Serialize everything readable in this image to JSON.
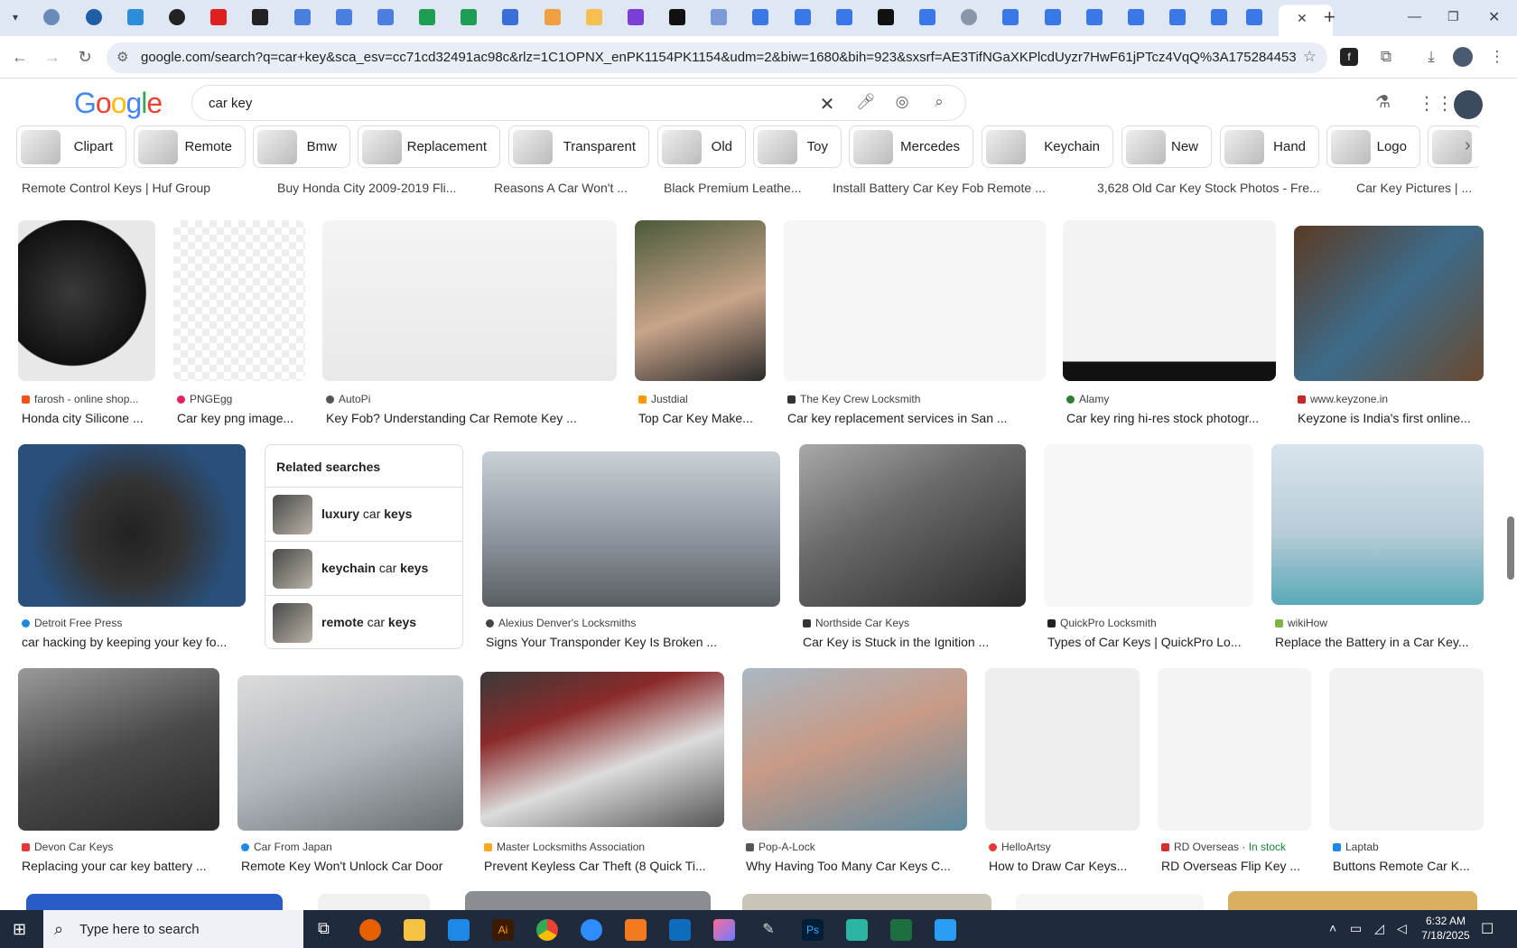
{
  "browser": {
    "url": "google.com/search?q=car+key&sca_esv=cc71cd32491ac98c&rlz=1C1OPNX_enPK1154PK1154&udm=2&biw=1680&bih=923&sxsrf=AE3TifNGaXKPlcdUyzr7HwF61jPTcz4VqQ%3A1752844531044&ei=80h...",
    "tab_close": "✕",
    "new_tab": "+"
  },
  "search": {
    "logo_letters": [
      "G",
      "o",
      "o",
      "g",
      "l",
      "e"
    ],
    "logo_colors": [
      "#4285F4",
      "#EA4335",
      "#FBBC05",
      "#4285F4",
      "#34A853",
      "#EA4335"
    ],
    "query": "car key"
  },
  "chips": [
    "Clipart",
    "Remote",
    "Bmw",
    "Replacement",
    "Transparent",
    "Old",
    "Toy",
    "Mercedes",
    "Keychain",
    "New",
    "Hand",
    "Logo"
  ],
  "top_captions": [
    "Remote Control Keys | Huf Group",
    "Buy Honda City 2009-2019 Fli...",
    "Reasons A Car Won't ...",
    "Black Premium Leathe...",
    "Install Battery Car Key Fob Remote ...",
    "3,628 Old Car Key Stock Photos - Fre...",
    "Car Key Pictures | ..."
  ],
  "rows": [
    [
      {
        "source": "farosh - online shop...",
        "title": "Honda city Silicone ...",
        "color": "#f4511e"
      },
      {
        "source": "PNGEgg",
        "title": "Car key png image...",
        "color": "#e91e63"
      },
      {
        "source": "AutoPi",
        "title": "Key Fob? Understanding Car Remote Key ...",
        "color": "#555555"
      },
      {
        "source": "Justdial",
        "title": "Top Car Key Make...",
        "color": "#ff9800"
      },
      {
        "source": "The Key Crew Locksmith",
        "title": "Car key replacement services in San ...",
        "color": "#333333"
      },
      {
        "source": "Alamy",
        "title": "Car key ring hi-res stock photogr...",
        "color": "#2e7d32"
      },
      {
        "source": "www.keyzone.in",
        "title": "Keyzone is India's first online...",
        "color": "#c62828"
      }
    ],
    [
      {
        "source": "Detroit Free Press",
        "title": "car hacking by keeping your key fo...",
        "color": "#1e88e5"
      },
      {
        "source": "Alexius Denver's Locksmiths",
        "title": "Signs Your Transponder Key Is Broken ...",
        "color": "#444444"
      },
      {
        "source": "Northside Car Keys",
        "title": "Car Key is Stuck in the Ignition ...",
        "color": "#333333"
      },
      {
        "source": "QuickPro Locksmith",
        "title": "Types of Car Keys | QuickPro Lo...",
        "color": "#222222"
      },
      {
        "source": "wikiHow",
        "title": "Replace the Battery in a Car Key...",
        "color": "#7cb342"
      }
    ],
    [
      {
        "source": "Devon Car Keys",
        "title": "Replacing your car key battery ...",
        "color": "#e53935"
      },
      {
        "source": "Car From Japan",
        "title": "Remote Key Won't Unlock Car Door",
        "color": "#1e88e5"
      },
      {
        "source": "Master Locksmiths Association",
        "title": "Prevent Keyless Car Theft (8 Quick Ti...",
        "color": "#f9a825"
      },
      {
        "source": "Pop-A-Lock",
        "title": "Why Having Too Many Car Keys C...",
        "color": "#555555"
      },
      {
        "source": "HelloArtsy",
        "title": "How to Draw Car Keys...",
        "color": "#e53935"
      },
      {
        "source": "RD Overseas",
        "title": "RD Overseas Flip Key ...",
        "color": "#d32f2f",
        "badge": "In stock"
      },
      {
        "source": "Laptab",
        "title": "Buttons Remote Car K...",
        "color": "#1e88e5"
      }
    ]
  ],
  "related": {
    "heading": "Related searches",
    "items": [
      {
        "bold1": "luxury",
        "plain": "car",
        "bold2": "keys"
      },
      {
        "bold1": "keychain",
        "plain": "car",
        "bold2": "keys"
      },
      {
        "bold1": "remote",
        "plain": "car",
        "bold2": "keys"
      }
    ]
  },
  "taskbar": {
    "search_placeholder": "Type here to search",
    "time": "6:32 AM",
    "date": "7/18/2025"
  }
}
